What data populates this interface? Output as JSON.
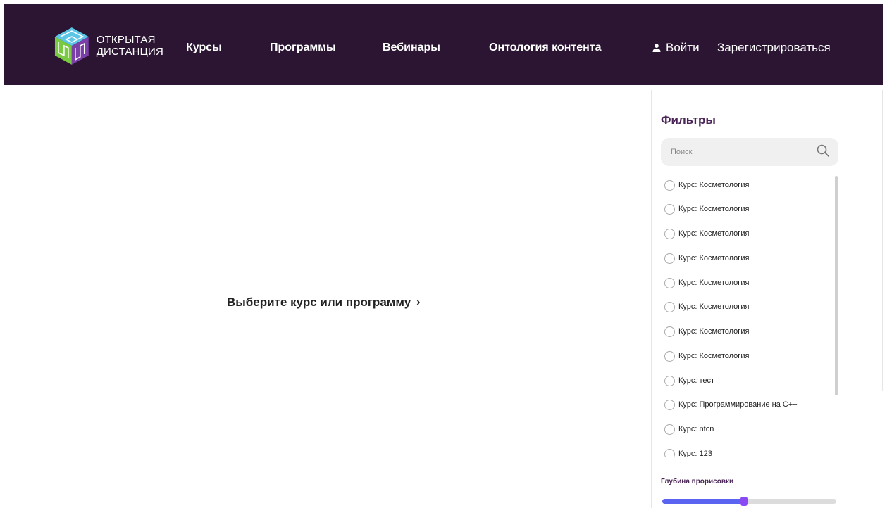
{
  "header": {
    "logo_line1": "ОТКРЫТАЯ",
    "logo_line2": "ДИСТАНЦИЯ",
    "nav": [
      "Курсы",
      "Программы",
      "Вебинары",
      "Онтология контента"
    ],
    "login_label": "Войти",
    "register_label": "Зарегистрироваться",
    "bg_color": "#2b1533"
  },
  "main": {
    "prompt": "Выберите курс или программу",
    "prompt_icon": "chevron-right-icon"
  },
  "filters": {
    "title": "Фильтры",
    "search_placeholder": "Поиск",
    "search_value": "",
    "search_icon": "search-icon",
    "items": [
      "Курс: Косметология",
      "Курс: Косметология",
      "Курс: Косметология",
      "Курс: Косметология",
      "Курс: Косметология",
      "Курс: Косметология",
      "Курс: Косметология",
      "Курс: Косметология",
      "Курс: тест",
      "Курс: Программирование на С++",
      "Курс: ntcn",
      "Курс: 123"
    ],
    "depth_label": "Глубина прорисовки",
    "depth_value": 0.45,
    "accent_color": "#5b64f0",
    "thumb_color": "#8a4af3",
    "title_color": "#4a2456"
  }
}
